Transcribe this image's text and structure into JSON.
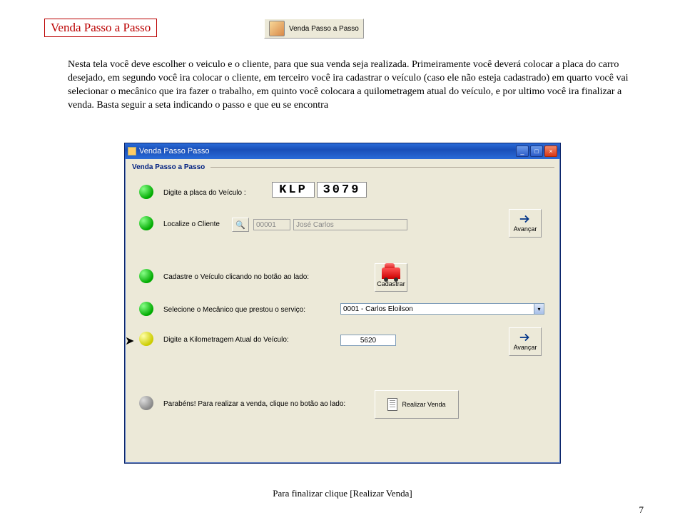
{
  "page_title": "Venda Passo a Passo",
  "inline_button_label": "Venda Passo a Passo",
  "intro_text": "Nesta tela você deve escolher o veiculo e o cliente, para que sua venda seja realizada. Primeiramente você deverá colocar a placa do carro desejado, em segundo você ira colocar o cliente, em terceiro você ira cadastrar o veículo (caso ele não esteja cadastrado) em quarto você vai selecionar o mecânico que ira fazer o trabalho, em quinto você colocara a quilometragem atual do veículo, e por ultimo você ira finalizar a venda. Basta seguir a seta indicando o passo e que eu se encontra",
  "window": {
    "title": "Venda Passo Passo",
    "group_title": "Venda Passo a Passo",
    "step1_label": "Digite a placa do Veículo :",
    "plate_letters": "KLP",
    "plate_numbers": "3079",
    "step2_label": "Localize o Cliente",
    "client_code": "00001",
    "client_name": "José Carlos",
    "advance_label": "Avançar",
    "step3_label": "Cadastre o Veículo clicando no botão ao lado:",
    "register_label": "Cadastrar",
    "step4_label": "Selecione o Mecânico que prestou o serviço:",
    "mechanic_selected": "0001 - Carlos Eloilson",
    "step5_label": "Digite a Kilometragem Atual do Veículo:",
    "km_value": "5620",
    "step6_label": "Parabéns! Para realizar a venda, clique no botão ao lado:",
    "finalize_label": "Realizar Venda"
  },
  "footer_text": "Para finalizar clique [Realizar Venda]",
  "page_number": "7"
}
